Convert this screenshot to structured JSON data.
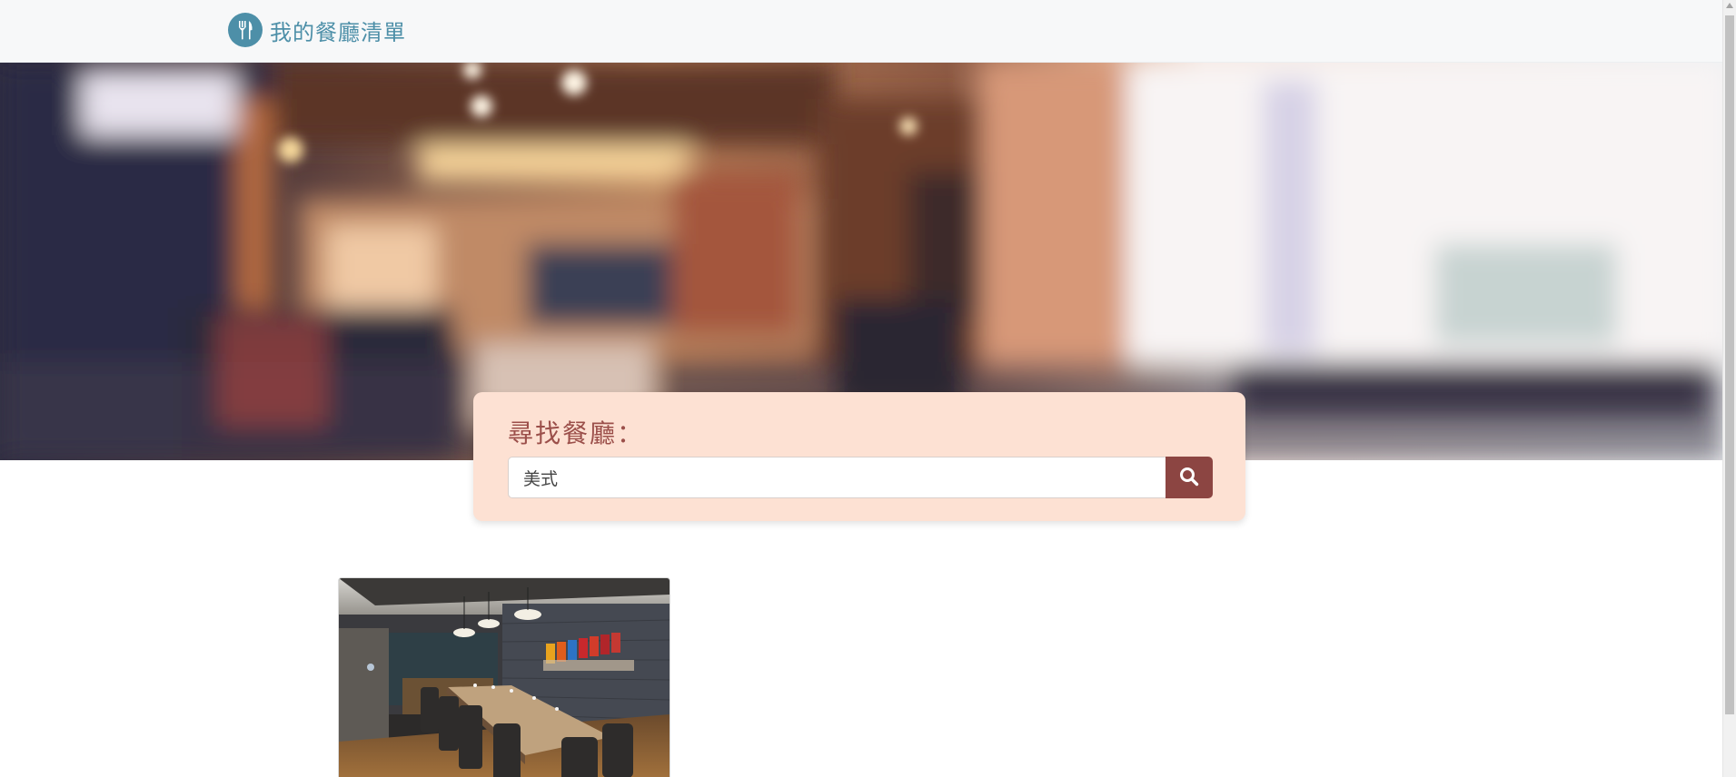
{
  "navbar": {
    "brand_text": "我的餐廳清單",
    "brand_icon": "fork-knife-icon",
    "brand_color": "#4d8fa8"
  },
  "search": {
    "title": "尋找餐廳：",
    "input_value": "美式",
    "button_icon": "search-icon",
    "panel_color": "#fde1d3",
    "button_color": "#8c4542"
  },
  "restaurants": [
    {
      "image": "restaurant-dining-room-photo"
    }
  ]
}
